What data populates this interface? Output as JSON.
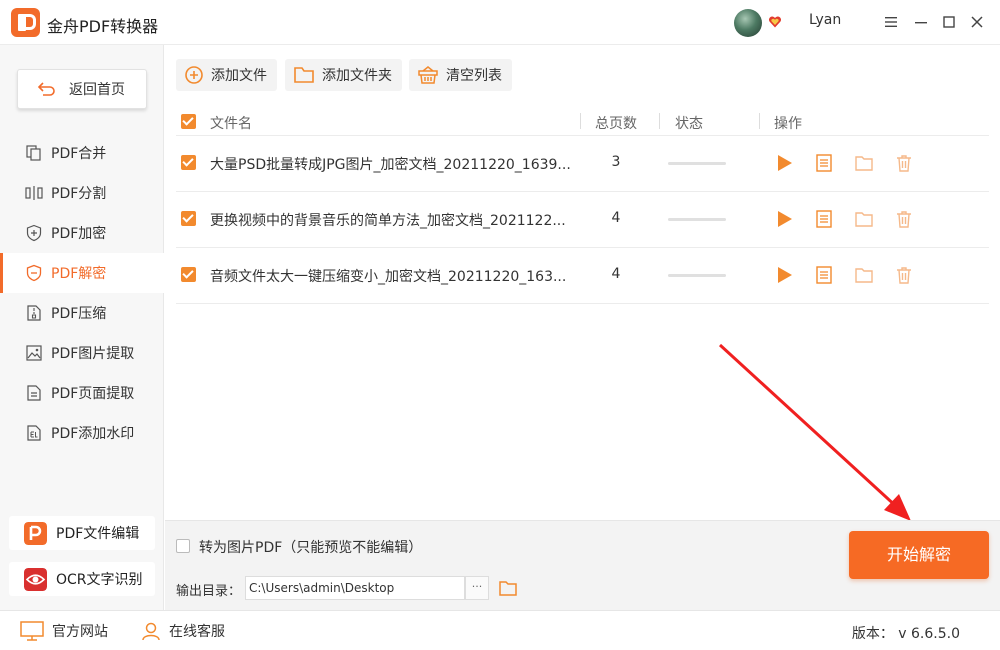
{
  "app": {
    "title": "金舟PDF转换器",
    "username": "Lyan",
    "accent": "#f26b2a"
  },
  "window_controls": [
    "menu-icon",
    "minimize-icon",
    "maximize-icon",
    "close-icon"
  ],
  "sidebar": {
    "back_label": "返回首页",
    "items": [
      {
        "label": "PDF合并",
        "icon": "merge-icon"
      },
      {
        "label": "PDF分割",
        "icon": "split-icon"
      },
      {
        "label": "PDF加密",
        "icon": "shield-plus-icon"
      },
      {
        "label": "PDF解密",
        "icon": "shield-minus-icon",
        "active": true
      },
      {
        "label": "PDF压缩",
        "icon": "compress-icon"
      },
      {
        "label": "PDF图片提取",
        "icon": "image-icon"
      },
      {
        "label": "PDF页面提取",
        "icon": "page-icon"
      },
      {
        "label": "PDF添加水印",
        "icon": "watermark-icon"
      }
    ],
    "tools": [
      {
        "label": "PDF文件编辑",
        "icon": "pdf-editor-icon",
        "color": "#f26b2a"
      },
      {
        "label": "OCR文字识别",
        "icon": "ocr-eye-icon",
        "color": "#d9302f"
      }
    ]
  },
  "toolbar": {
    "add_file": "添加文件",
    "add_folder": "添加文件夹",
    "clear_list": "清空列表"
  },
  "table": {
    "headers": {
      "name": "文件名",
      "pages": "总页数",
      "status": "状态",
      "ops": "操作"
    },
    "rows": [
      {
        "name": "大量PSD批量转成JPG图片_加密文档_20211220_1639...",
        "pages": "3",
        "progress": 0
      },
      {
        "name": "更换视频中的背景音乐的简单方法_加密文档_2021122...",
        "pages": "4",
        "progress": 0
      },
      {
        "name": "音频文件太大一键压缩变小_加密文档_20211220_163...",
        "pages": "4",
        "progress": 0
      }
    ]
  },
  "bottom": {
    "convert_to_image_label": "转为图片PDF（只能预览不能编辑）",
    "output_label": "输出目录：",
    "output_path": "C:\\Users\\admin\\Desktop",
    "more_label": "···",
    "start_label": "开始解密"
  },
  "statusbar": {
    "website": "官方网站",
    "support": "在线客服",
    "version": "版本： v 6.6.5.0"
  }
}
